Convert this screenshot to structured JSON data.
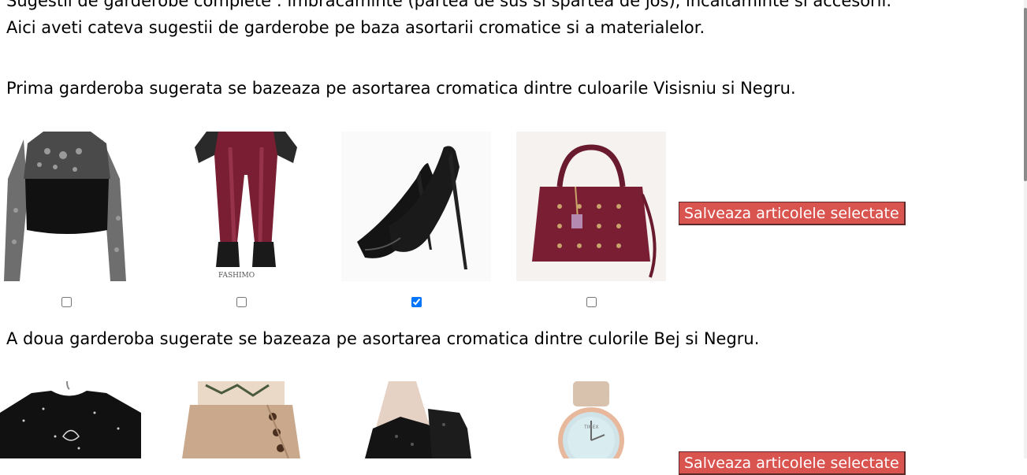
{
  "intro": {
    "line1": "Sugestii de garderobe complete : imbracaminte (partea de sus si spartea de jos), incaltaminte si accesorii.",
    "line2": "Aici aveti cateva sugestii de garderobe pe baza asortarii cromatice si a materialelor."
  },
  "outfit1": {
    "description": "Prima garderoba sugerata se bazeaza pe asortarea cromatica dintre culoarile Visisniu si Negru.",
    "items": [
      {
        "name": "black-lace-top",
        "checked": false
      },
      {
        "name": "burgundy-leather-pants",
        "checked": false,
        "brand": "FASHIMO"
      },
      {
        "name": "black-stiletto-heels",
        "checked": true
      },
      {
        "name": "burgundy-handbag",
        "checked": false
      }
    ],
    "save_label": "Salveaza articolele selectate"
  },
  "outfit2": {
    "description": "A doua garderoba sugerate se bazeaza pe asortarea cromatica dintre culorile Bej si Negru.",
    "items": [
      {
        "name": "black-graphic-tshirt"
      },
      {
        "name": "beige-button-skirt"
      },
      {
        "name": "black-lace-ankle-boots"
      },
      {
        "name": "beige-strap-watch",
        "brand": "TIMEX"
      }
    ],
    "save_label": "Salveaza articolele selectate"
  },
  "colors": {
    "button_bg": "#d9534f",
    "burgundy": "#7a1e33",
    "black": "#111111",
    "beige": "#d2b59b"
  }
}
